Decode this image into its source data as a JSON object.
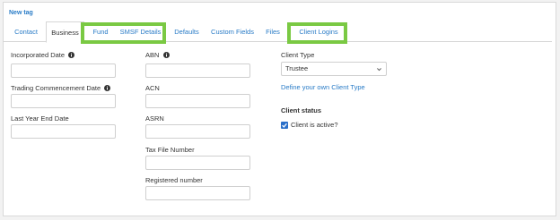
{
  "header": {
    "new_tag_link": "New tag"
  },
  "tabs": [
    {
      "label": "Contact",
      "active": false
    },
    {
      "label": "Business",
      "active": true
    },
    {
      "label": "Fund",
      "active": false,
      "highlighted": true
    },
    {
      "label": "SMSF Details",
      "active": false,
      "highlighted": true
    },
    {
      "label": "Defaults",
      "active": false
    },
    {
      "label": "Custom Fields",
      "active": false
    },
    {
      "label": "Files",
      "active": false
    },
    {
      "label": "Client Logins",
      "active": false,
      "highlighted": true
    }
  ],
  "highlight_color": "#7ac943",
  "accent_color": "#2a7cc7",
  "form": {
    "col1": {
      "incorporated_date_label": "Incorporated Date",
      "trading_commencement_date_label": "Trading Commencement Date",
      "last_year_end_date_label": "Last Year End Date"
    },
    "col2": {
      "abn_label": "ABN",
      "acn_label": "ACN",
      "asrn_label": "ASRN",
      "tax_file_number_label": "Tax File Number",
      "registered_number_label": "Registered number"
    },
    "col3": {
      "client_type_label": "Client Type",
      "client_type_value": "Trustee",
      "define_client_type_link": "Define your own Client Type",
      "client_status_title": "Client status",
      "client_active_label": "Client is active?",
      "client_active_checked": true
    }
  }
}
